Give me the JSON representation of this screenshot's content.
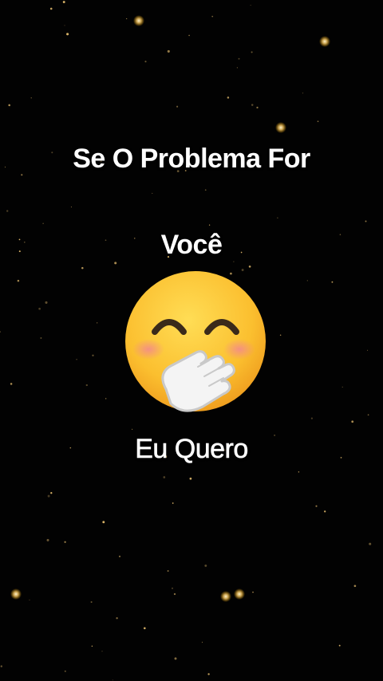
{
  "captions": {
    "line1": "Se O Problema For",
    "line2": "Você",
    "line3": "Eu Quero"
  },
  "emoji": {
    "icon": "face-with-hand-over-mouth-icon"
  },
  "colors": {
    "background": "#020202",
    "text": "#ffffff",
    "star": "#ffd27a",
    "emoji_face": "#fbbf2f",
    "emoji_blush": "#f38b8b",
    "emoji_hand": "#f4f4f4"
  }
}
